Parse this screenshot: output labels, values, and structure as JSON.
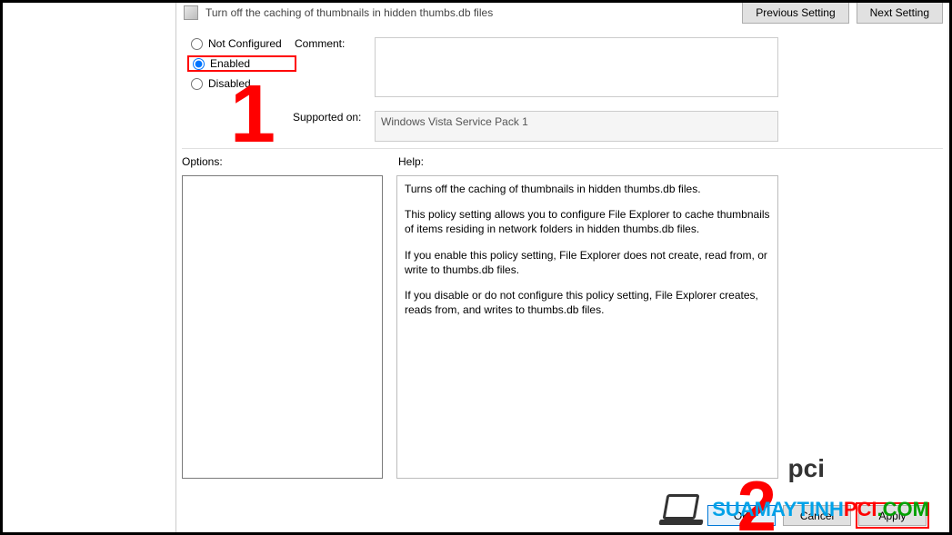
{
  "policy_title": "Turn off the caching of thumbnails in hidden thumbs.db files",
  "nav": {
    "prev": "Previous Setting",
    "next": "Next Setting"
  },
  "radios": {
    "not_configured": "Not Configured",
    "enabled": "Enabled",
    "disabled": "Disabled",
    "selected": "Enabled"
  },
  "labels": {
    "comment": "Comment:",
    "supported": "Supported on:",
    "options": "Options:",
    "help": "Help:"
  },
  "comment_value": "",
  "supported_value": "Windows Vista Service Pack 1",
  "help_paragraphs": [
    "Turns off the caching of thumbnails in hidden thumbs.db files.",
    "This policy setting allows you to configure File Explorer to cache thumbnails of items residing in network folders in hidden thumbs.db files.",
    "If you enable this policy setting, File Explorer does not create, read from, or write to thumbs.db files.",
    "If you disable or do not configure this policy setting, File Explorer creates, reads from, and writes to thumbs.db files."
  ],
  "buttons": {
    "ok": "OK",
    "cancel": "Cancel",
    "apply": "Apply"
  },
  "annotations": {
    "one": "1",
    "two": "2"
  },
  "watermark": {
    "pci": "pci",
    "t1": "SUAMAYTINH",
    "t2": "PCI",
    "t3": ".COM"
  }
}
